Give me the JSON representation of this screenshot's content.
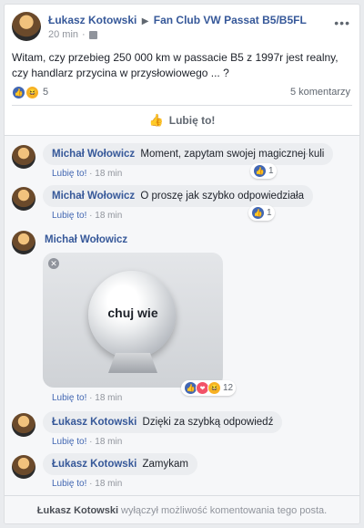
{
  "post": {
    "author": "Łukasz Kotowski",
    "arrow": "▶",
    "group": "Fan Club VW Passat B5/B5FL",
    "time": "20 min",
    "text": "Witam, czy przebieg 250 000 km w passacie B5 z 1997r jest realny, czy handlarz przycina w przysłowiowego ... ?",
    "reaction_count": "5",
    "comments_count": "5 komentarzy",
    "like_label": "Lubię to!"
  },
  "comments": [
    {
      "author": "Michał Wołowicz",
      "text": "Moment, zapytam swojej magicznej kuli",
      "like": "Lubię to!",
      "dot": "·",
      "time": "18 min",
      "reactions": "1"
    },
    {
      "author": "Michał Wołowicz",
      "text": "O proszę jak szybko odpowiedziała",
      "like": "Lubię to!",
      "dot": "·",
      "time": "18 min",
      "reactions": "1"
    },
    {
      "author": "Michał Wołowicz",
      "image_text": "chuj wie",
      "like": "Lubię to!",
      "dot": "·",
      "time": "18 min",
      "reactions": "12"
    },
    {
      "author": "Łukasz Kotowski",
      "text": "Dzięki za szybką odpowiedź",
      "like": "Lubię to!",
      "dot": "·",
      "time": "18 min"
    },
    {
      "author": "Łukasz Kotowski",
      "text": "Zamykam",
      "like": "Lubię to!",
      "dot": "·",
      "time": "18 min"
    }
  ],
  "footer": {
    "name": "Łukasz Kotowski",
    "text": "wyłączył możliwość komentowania tego posta."
  },
  "colors": {
    "link": "#365899",
    "like_blue": "#4267b2",
    "muted": "#90949c",
    "haha": "#f7b125",
    "love": "#f25268"
  },
  "icons": [
    "group-icon",
    "more-icon",
    "like-reaction-icon",
    "haha-reaction-icon",
    "love-reaction-icon",
    "thumbs-up-icon",
    "close-icon"
  ]
}
